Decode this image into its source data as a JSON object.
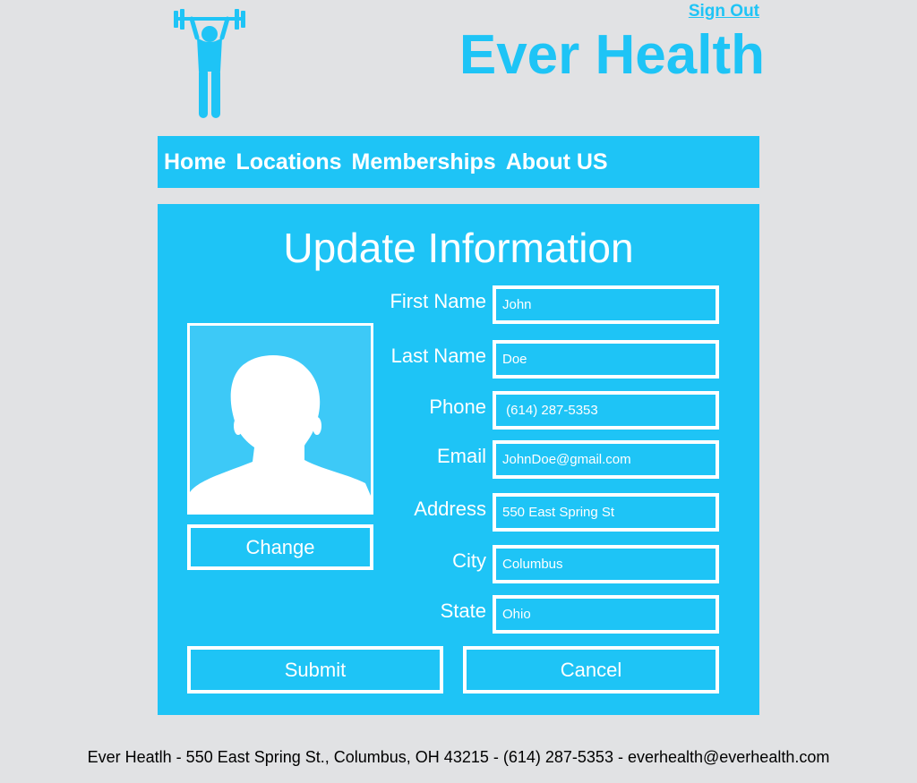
{
  "header": {
    "sign_out": "Sign Out",
    "title": "Ever Health",
    "logo_icon": "weightlifter-icon"
  },
  "nav": {
    "items": [
      {
        "label": "Home"
      },
      {
        "label": "Locations"
      },
      {
        "label": "Memberships"
      },
      {
        "label": "About US"
      }
    ]
  },
  "form": {
    "title": "Update Information",
    "photo_icon": "person-silhouette-icon",
    "change_label": "Change",
    "fields": [
      {
        "label": "First Name",
        "value": "John"
      },
      {
        "label": "Last Name",
        "value": "Doe"
      },
      {
        "label": "Phone",
        "value": " (614) 287-5353"
      },
      {
        "label": "Email",
        "value": "JohnDoe@gmail.com"
      },
      {
        "label": "Address",
        "value": "550 East Spring St"
      },
      {
        "label": "City",
        "value": "Columbus"
      },
      {
        "label": "State",
        "value": "Ohio"
      }
    ],
    "submit_label": "Submit",
    "cancel_label": "Cancel"
  },
  "footer": {
    "text": "Ever Heatlh - 550 East Spring St., Columbus, OH 43215 - (614) 287-5353 - everhealth@everhealth.com"
  },
  "colors": {
    "accent": "#1ec4f6",
    "background": "#e1e2e4",
    "text_on_accent": "#ffffff"
  }
}
